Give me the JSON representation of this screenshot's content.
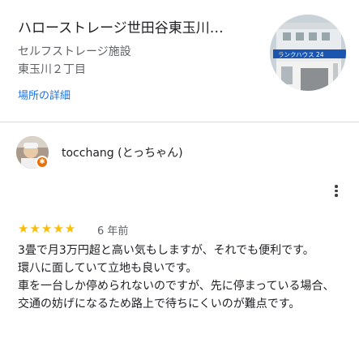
{
  "place": {
    "title": "ハローストレージ世田谷東玉川…",
    "category": "セルフストレージ施設",
    "address": "東玉川２丁目",
    "details_link": "場所の詳細",
    "thumbnail_sign_text": "ランクハウス 24"
  },
  "review": {
    "reviewer_name": "tocchang (とっちゃん)",
    "rating": 5,
    "stars": "★★★★★",
    "time_ago": "6 年前",
    "text": "3畳で月3万円超と高い気もしますが、それでも便利です。\n環八に面していて立地も良いです。\n車を一台しか停められないのですが、先に停まっている場合、交通の妨げになるため路上で待ちにくいのが難点です。"
  },
  "colors": {
    "accent_link": "#1a73e8",
    "star": "#fbbc04",
    "local_guide_badge": "#e8710a"
  }
}
